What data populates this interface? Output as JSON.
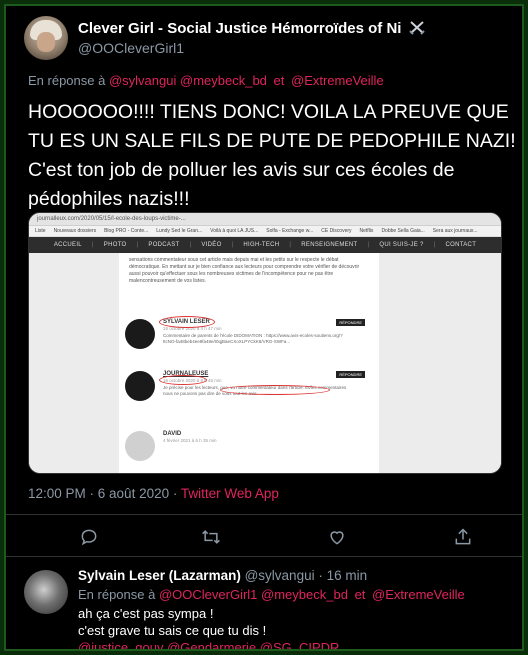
{
  "tweet": {
    "author_name": "Clever Girl - Social Justice Hémorroïdes of Ni",
    "author_badge_icon": "crossed-swords-icon",
    "author_handle": "@OOCleverGirl1",
    "reply_prefix": "En réponse à",
    "reply_mentions": [
      "@sylvangui",
      "@meybeck_bd",
      "et",
      "@ExtremeVeille"
    ],
    "text_line1": "HOOOOOO!!!! TIENS DONC! VOILA LA PREUVE QUE",
    "text_line2": "TU ES UN SALE FILS DE PUTE DE PEDOPHILE NAZI!",
    "text_line3": "C'est ton job de polluer les avis sur ces écoles de",
    "text_line4": "pédophiles nazis!!!",
    "timestamp": "12:00 PM · 6 août 2020 ·",
    "source": "Twitter Web App",
    "accent_color": "#e0245e"
  },
  "media": {
    "url_text": "journalleux.com/2020/05/15/l-ecole-des-loups-victime-...",
    "bookmarks": [
      "Liste",
      "Nouveaux dossiers",
      "Blog PRO - Conte...",
      "Lundy Sed le Gran...",
      "Voilà à quoi LA JUS...",
      "Solfa - Exchange w...",
      "CE Discovery",
      "Netflix",
      "Dobbe Sella Gaia...",
      "Sera aux journaux..."
    ],
    "site_nav": [
      "ACCUEIL",
      "PHOTO",
      "PODCAST",
      "VIDÉO",
      "HIGH-TECH",
      "RENSEIGNEMENT",
      "QUI SUIS-JE ?",
      "CONTACT"
    ],
    "intro_text": "sensations commentateur sous cet article mais depuis mai et les petits sur le respecte le débat démocratique. En mettant sur je bien confiance aux lecteurs pour comprendre votre vérifier de découvrir aussi pouvoir qu'effectuer sous les nombreuses victimes de l'incompétence pour ne pas être malencontreusement de vos listes.",
    "comments": [
      {
        "name": "SYLVAIN LESER",
        "date": "15 octobre 2020 à 4 h 47 min",
        "body": "Commentaire de parents de l'école DIDOMATION : https://www.avis-ecoles-soutiens.org/?ItcNO-fa48beb4ee9fa48e/I0qjBaeCXoXLPYCkK8/VRG-SWFa...",
        "reply": "RÉPONDRE"
      },
      {
        "name": "JOURNALEUSE",
        "date": "16 octobre 2020 à 8 h 45 min",
        "body": "Je précise pour les lecteurs, que, vu notre commentateur dans l'article. Ils/les commentaires nous ne pouvons pas dire de vous tout les avis.",
        "reply": "RÉPONDRE"
      },
      {
        "name": "DAVID",
        "date": "4 février 2021 à 6 h 35 min",
        "body": "",
        "reply": ""
      }
    ]
  },
  "reply": {
    "author_name": "Sylvain Leser (Lazarman)",
    "author_handle": "@sylvangui",
    "separator": "·",
    "age": "16 min",
    "reply_prefix": "En réponse à",
    "reply_mentions": [
      "@OOCleverGirl1",
      "@meybeck_bd",
      "et",
      "@ExtremeVeille"
    ],
    "text_line1": "ah ça c'est pas sympa !",
    "text_line2": "c'est grave tu sais ce que tu dis !",
    "tags": "@justice_gouv @Gendarmerie @SG_CIPDR"
  },
  "actions": {
    "icons": [
      "reply-icon",
      "retweet-icon",
      "like-icon",
      "share-icon"
    ]
  }
}
